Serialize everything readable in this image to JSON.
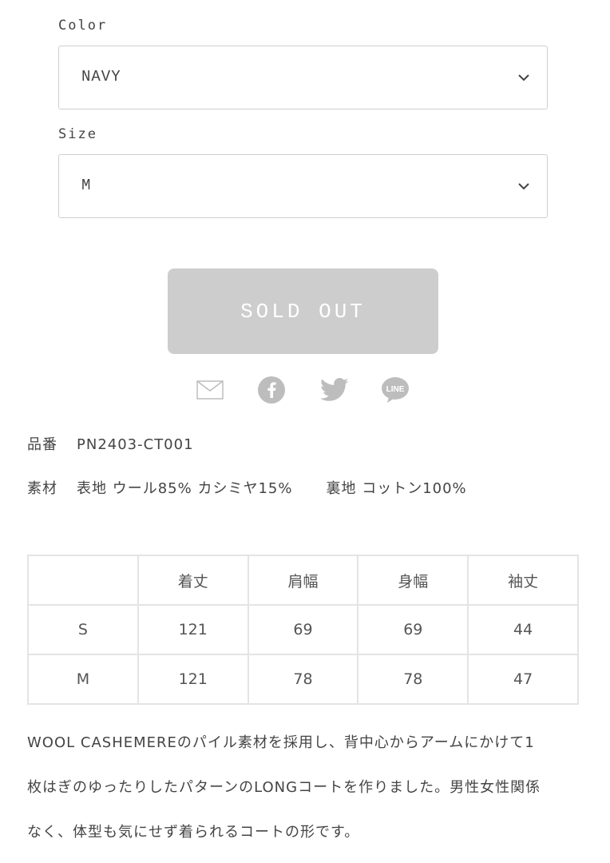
{
  "color": {
    "label": "Color",
    "value": "NAVY"
  },
  "size": {
    "label": "Size",
    "value": "M"
  },
  "sold_out_label": "SOLD OUT",
  "share": [
    "mail-icon",
    "facebook-icon",
    "twitter-icon",
    "line-icon"
  ],
  "share_line_text": "LINE",
  "product_number": {
    "label": "品番",
    "value": "PN2403-CT001"
  },
  "material": {
    "label": "素材",
    "outer": "表地 ウール85% カシミヤ15%",
    "lining": "裏地 コットン100%"
  },
  "size_table": {
    "headers": [
      "",
      "着丈",
      "肩幅",
      "身幅",
      "袖丈"
    ],
    "rows": [
      [
        "S",
        "121",
        "69",
        "69",
        "44"
      ],
      [
        "M",
        "121",
        "78",
        "78",
        "47"
      ]
    ]
  },
  "description": [
    "WOOL CASHEMEREのパイル素材を採用し、背中心からアームにかけて1",
    "枚はぎのゆったりしたパターンのLONGコートを作りました。男性女性関係",
    "なく、体型も気にせず着られるコートの形です。"
  ],
  "colors": {
    "border": "#cfcfcf",
    "soldout_bg": "#cdcdcd",
    "icon": "#bdbdbd",
    "text": "#444444"
  }
}
